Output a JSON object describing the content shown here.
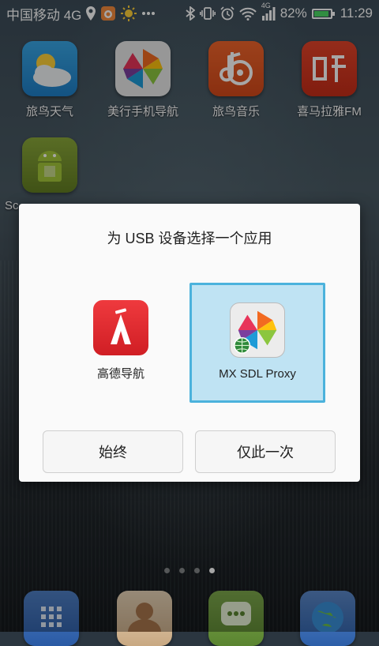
{
  "status_bar": {
    "carrier": "中国移动 4G",
    "network_small": "4G",
    "battery_percent": "82%",
    "battery_level": 0.82,
    "time": "11:29",
    "icons": [
      "location-icon",
      "notification-app-icon",
      "weather-sun-icon",
      "more-dots-icon",
      "bluetooth-icon",
      "vibrate-icon",
      "alarm-icon",
      "wifi-icon",
      "signal-icon",
      "battery-icon"
    ]
  },
  "home": {
    "apps": [
      {
        "label": "旅鸟天气",
        "icon": "weather-app-icon"
      },
      {
        "label": "美行手机导航",
        "icon": "pinwheel-app-icon"
      },
      {
        "label": "旅鸟音乐",
        "icon": "music-app-icon"
      },
      {
        "label": "喜马拉雅FM",
        "icon": "ximalaya-app-icon"
      },
      {
        "label": "Sc",
        "icon": "android-app-icon"
      }
    ],
    "dock": [
      "dialer-icon",
      "contacts-icon",
      "messages-icon",
      "browser-icon"
    ],
    "page_dots": {
      "count": 4,
      "active": 3
    }
  },
  "dialog": {
    "title": "为 USB 设备选择一个应用",
    "options": [
      {
        "label": "高德导航",
        "icon": "amap-icon",
        "selected": false
      },
      {
        "label": "MX SDL Proxy",
        "icon": "pinwheel-globe-icon",
        "selected": true
      }
    ],
    "always_label": "始终",
    "once_label": "仅此一次"
  },
  "colors": {
    "selection_bg": "#bfe3f3",
    "selection_border": "#4bb2dc",
    "battery_fill": "#4cd964"
  }
}
